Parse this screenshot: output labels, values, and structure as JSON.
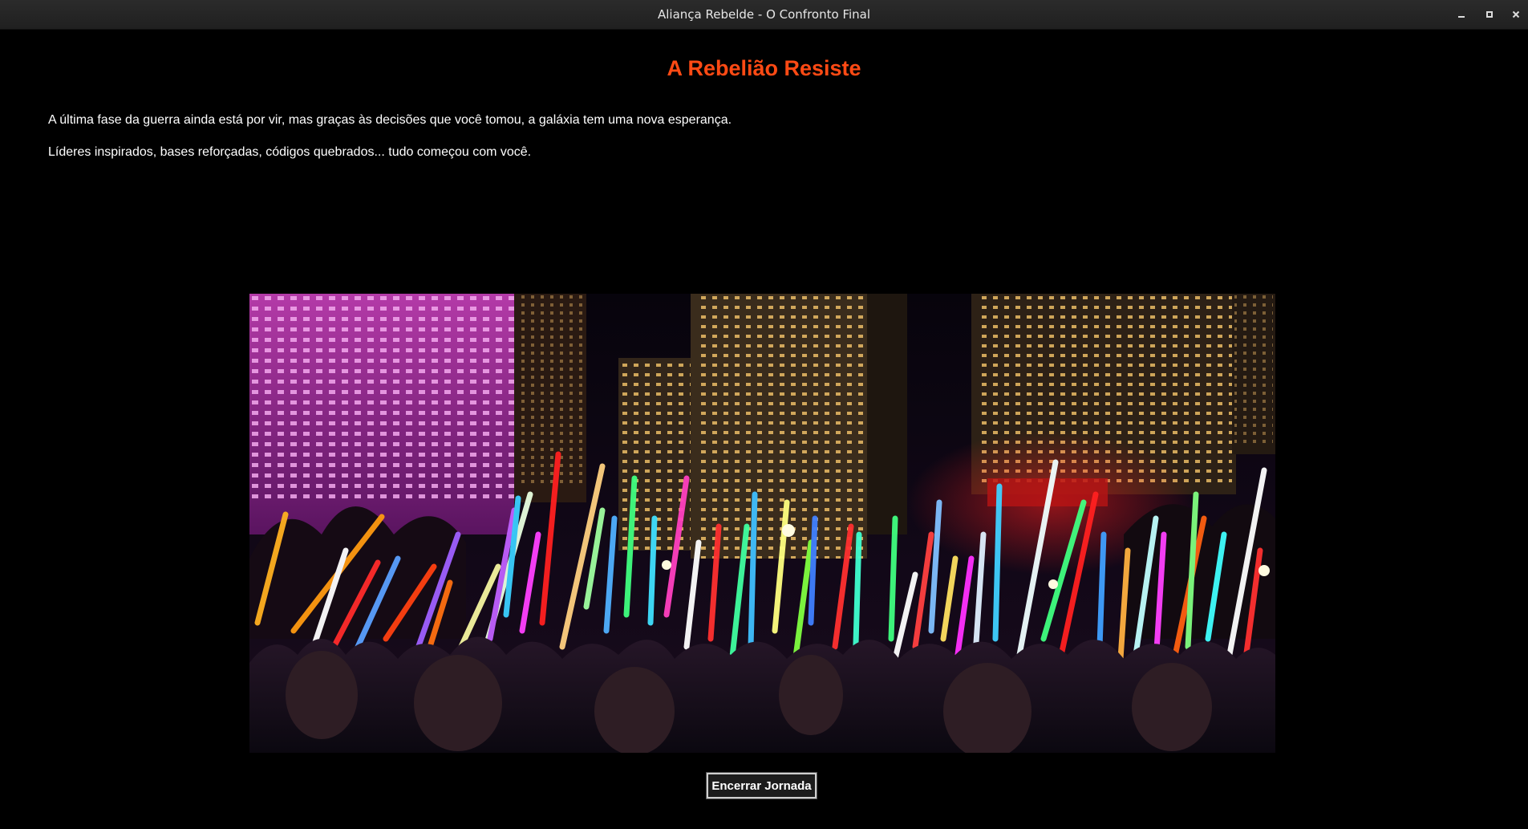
{
  "window": {
    "title": "Aliança Rebelde - O Confronto Final"
  },
  "page": {
    "heading": "A Rebelião Resiste",
    "paragraphs": [
      "A última fase da guerra ainda está por vir, mas graças às decisões que você tomou, a galáxia tem uma nova esperança.",
      "Líderes inspirados, bases reforçadas, códigos quebrados... tudo começou com você."
    ],
    "image": {
      "subject": "crowd-raising-lightsabers-at-night-city"
    },
    "end_button_label": "Encerrar Jornada"
  },
  "colors": {
    "heading": "#ff4a14",
    "background": "#000000",
    "text": "#ffffff"
  },
  "icons": {
    "minimize": "minimize-icon",
    "maximize": "maximize-icon",
    "close": "close-icon"
  }
}
